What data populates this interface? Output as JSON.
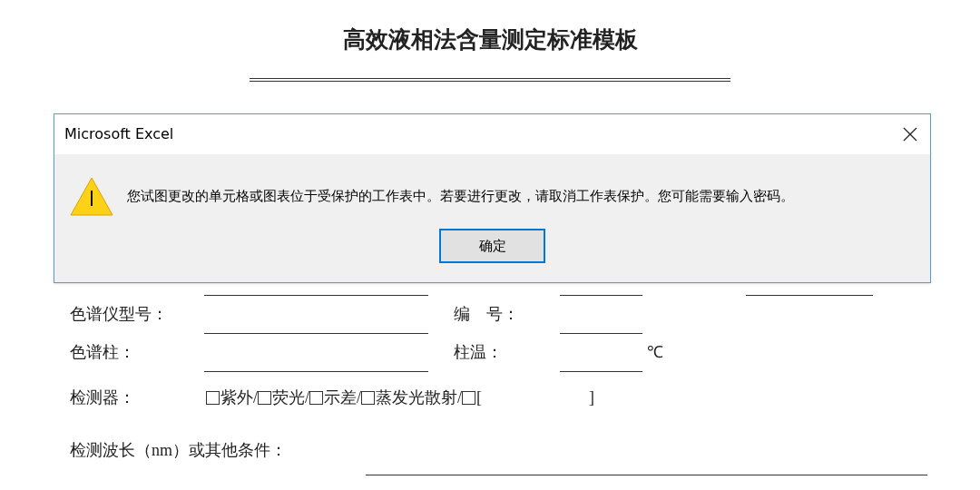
{
  "document": {
    "title": "高效液相法含量测定标准模板",
    "rows": [
      {
        "kind": "covered"
      },
      {
        "kind": "pair",
        "label": "色谱仪型号：",
        "label_2": "编　号："
      },
      {
        "kind": "pair",
        "label": "色谱柱：",
        "label_2": "柱温：",
        "unit": "℃"
      },
      {
        "kind": "choices",
        "label": "检测器：",
        "separator": "/",
        "options": [
          {
            "label": "紫外",
            "checked": false
          },
          {
            "label": "荧光",
            "checked": false
          },
          {
            "label": "示差",
            "checked": false
          },
          {
            "label": "蒸发光散射",
            "checked": false
          }
        ],
        "other": {
          "checked": false,
          "open": "[",
          "close": "]"
        }
      },
      {
        "kind": "long",
        "label": "检测波长（nm）或其他条件："
      }
    ]
  },
  "dialog": {
    "title": "Microsoft Excel",
    "message": "您试图更改的单元格或图表位于受保护的工作表中。若要进行更改，请取消工作表保护。您可能需要输入密码。",
    "button": "确定"
  }
}
